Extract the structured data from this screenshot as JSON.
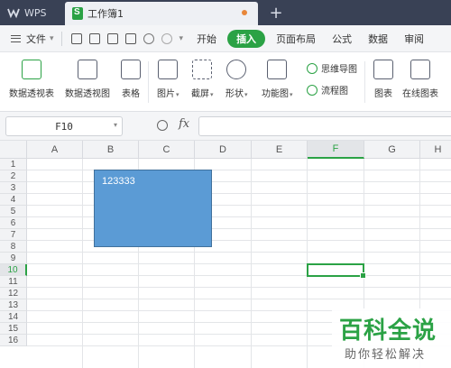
{
  "titlebar": {
    "app_label": "WPS",
    "doc_title": "工作簿1",
    "new_tab": "+"
  },
  "menubar": {
    "file_label": "文件",
    "items": [
      "开始",
      "插入",
      "页面布局",
      "公式",
      "数据",
      "审阅"
    ],
    "active": "插入"
  },
  "ribbon": {
    "pivot_table": "数据透视表",
    "pivot_chart": "数据透视图",
    "table": "表格",
    "picture": "图片",
    "screenshot": "截屏",
    "shapes": "形状",
    "function_chart": "功能图",
    "mind_map": "思维导图",
    "flowchart": "流程图",
    "chart": "图表",
    "online_chart": "在线图表"
  },
  "formula_bar": {
    "cell_ref": "F10",
    "fx": "fx",
    "formula": ""
  },
  "grid": {
    "columns": [
      "A",
      "B",
      "C",
      "D",
      "E",
      "F",
      "G",
      "H"
    ],
    "rows": [
      "1",
      "2",
      "3",
      "4",
      "5",
      "6",
      "7",
      "8",
      "9",
      "10",
      "11",
      "12",
      "13",
      "14",
      "15",
      "16"
    ],
    "selected_column": "F",
    "selected_row": "10",
    "shape_text": "123333"
  },
  "watermark": {
    "title": "百科全说",
    "subtitle": "助你轻松解决"
  },
  "colors": {
    "accent": "#2ba245",
    "titlebar": "#394155",
    "shape_fill": "#5b9bd5"
  }
}
